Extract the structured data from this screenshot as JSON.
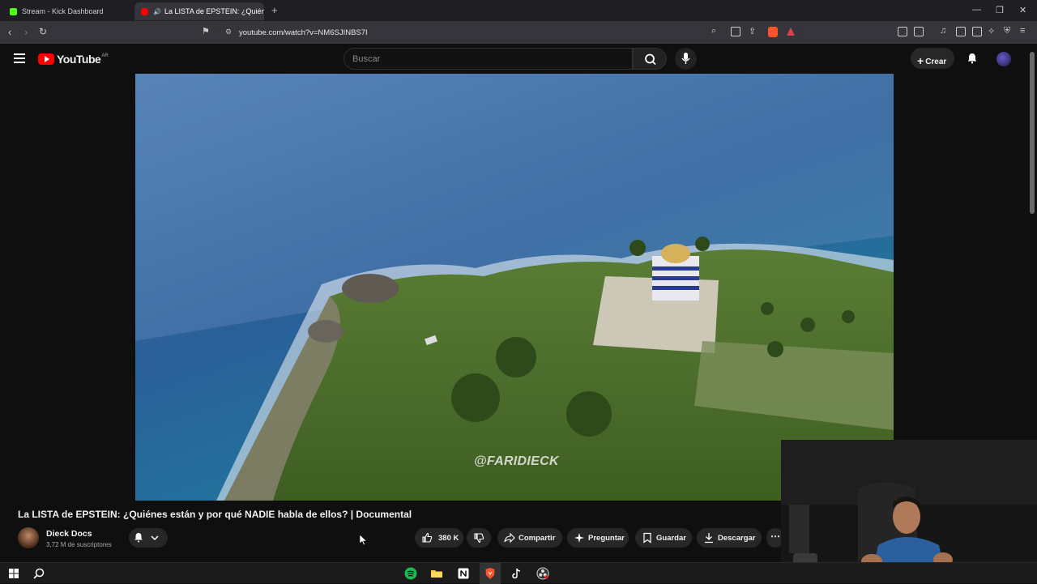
{
  "browser": {
    "tabs": [
      {
        "label": "Stream - Kick Dashboard",
        "favicon_color": "#53fc18"
      },
      {
        "label": "La LISTA de EPSTEIN: ¿Quiéne",
        "favicon_color": "#ff0000",
        "active": true
      }
    ],
    "url": "youtube.com/watch?v=NM6SJINBS7I"
  },
  "youtube": {
    "logo_text": "YouTube",
    "country_code": "AR",
    "search_placeholder": "Buscar",
    "create_label": "Crear"
  },
  "video": {
    "watermark": "@FARIDIECK",
    "title": "La LISTA de EPSTEIN: ¿Quiénes están y por qué NADIE habla de ellos? | Documental",
    "channel_name": "Dieck Docs",
    "subscribers": "3,72 M de suscriptores",
    "likes": "380 K",
    "actions": {
      "share": "Compartir",
      "ask": "Preguntar",
      "save": "Guardar",
      "download": "Descargar"
    }
  },
  "taskbar": {
    "icons": [
      "windows-icon",
      "search-icon",
      "spotify-icon",
      "file-explorer-icon",
      "notion-icon",
      "brave-icon",
      "tiktok-icon",
      "obs-icon"
    ]
  }
}
